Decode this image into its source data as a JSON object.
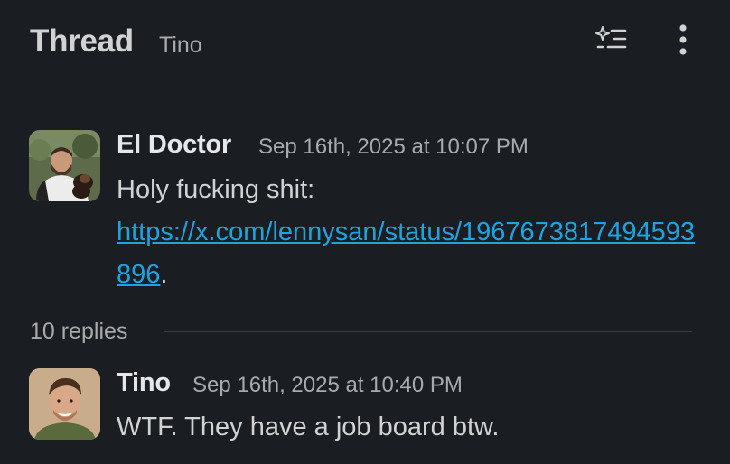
{
  "header": {
    "title": "Thread",
    "channel": "Tino",
    "summarize_icon": "sparkle-list-icon",
    "more_icon": "vertical-ellipsis-icon"
  },
  "parent_message": {
    "author": "El Doctor",
    "timestamp": "Sep 16th, 2025 at 10:07 PM",
    "text": "Holy fucking shit:",
    "link": "https://x.com/lennysan/status/1967673817494593896",
    "link_suffix": "."
  },
  "replies": {
    "count_label": "10 replies"
  },
  "reply_message": {
    "author": "Tino",
    "timestamp": "Sep 16th, 2025 at 10:40 PM",
    "text": "WTF. They have a job board btw."
  },
  "colors": {
    "background": "#1a1d21",
    "text": "#d1d2d3",
    "muted": "#a9aaac",
    "link": "#1ea3e0"
  }
}
